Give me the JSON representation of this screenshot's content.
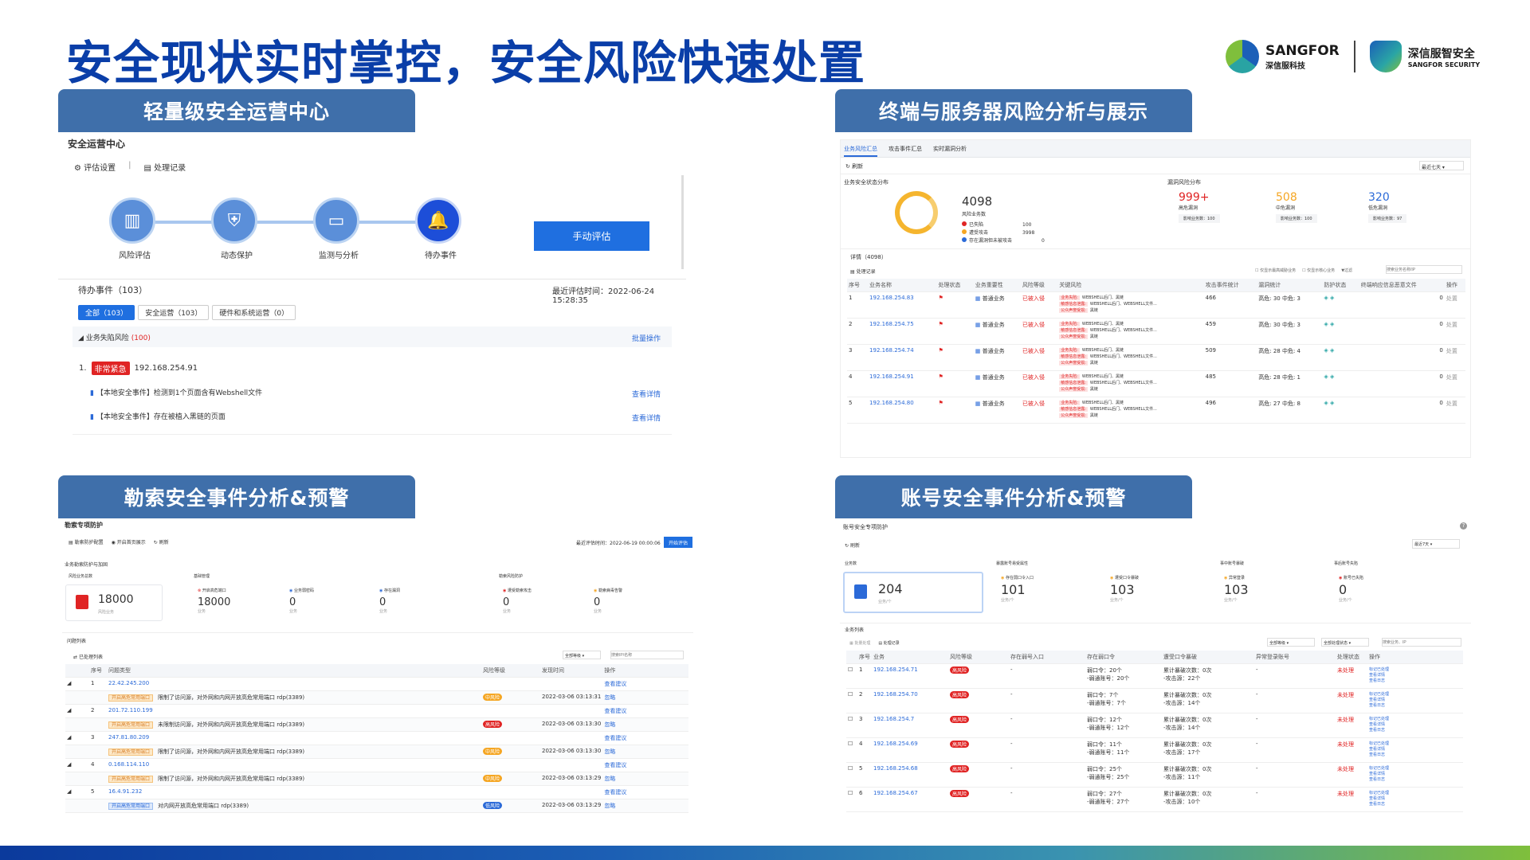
{
  "header": {
    "title": "安全现状实时掌控，安全风险快速处置",
    "logo1": {
      "name": "SANGFOR",
      "sub": "深信服科技"
    },
    "logo2": {
      "name": "深信服智安全",
      "sub": "SANGFOR SECURITY"
    }
  },
  "sections": {
    "s1": "轻量级安全运营中心",
    "s2": "终端与服务器风险分析与展示",
    "s3": "勒索安全事件分析&预警",
    "s4": "账号安全事件分析&预警"
  },
  "soc": {
    "title": "安全运营中心",
    "toolbar": {
      "settings": "评估设置",
      "records": "处理记录"
    },
    "steps": [
      "风险评估",
      "动态保护",
      "监测与分析",
      "待办事件"
    ],
    "manual_btn": "手动评估",
    "pending": "待办事件（103）",
    "last_eval": "最近评估时间：2022-06-24 15:28:35",
    "tabs": [
      "全部（103）",
      "安全运营（103）",
      "硬件和系统运营（0）"
    ],
    "group": "业务失陷风险",
    "group_count": "(100)",
    "batch": "批量操作",
    "item_no": "1.",
    "item_tag": "非常紧急",
    "item_ip": "192.168.254.91",
    "events": [
      "【本地安全事件】检测到1个页面含有Webshell文件",
      "【本地安全事件】存在被植入黑链的页面"
    ],
    "detail": "查看详情"
  },
  "terminal": {
    "tabs": [
      "业务风险汇总",
      "攻击事件汇总",
      "实时漏洞分析"
    ],
    "refresh": "刷新",
    "range": "最近七天",
    "biz_title": "业务安全状态分布",
    "total": "4098",
    "total_label": "风险业务数",
    "legend": [
      {
        "label": "已失陷",
        "value": "100",
        "color": "#e02424"
      },
      {
        "label": "遭受攻击",
        "value": "3998",
        "color": "#f5a623"
      },
      {
        "label": "存在漏洞但未被攻击",
        "value": "0",
        "color": "#2b6ad8"
      }
    ],
    "vuln_title": "漏洞风险分布",
    "vulns": [
      {
        "value": "999+",
        "label": "高危漏洞",
        "btn": "影响业务数：100",
        "color": "#e02424"
      },
      {
        "value": "508",
        "label": "中危漏洞",
        "btn": "影响业务数：100",
        "color": "#f5a623"
      },
      {
        "value": "320",
        "label": "低危漏洞",
        "btn": "影响业务数：97",
        "color": "#2b6ad8"
      }
    ],
    "detail_title": "详情（4098）",
    "process": "处理记录",
    "filters": [
      "仅显示最高威胁业务",
      "仅显示核心业务",
      "过滤"
    ],
    "search_ph": "搜索业务名称/IP",
    "columns": [
      "序号",
      "业务名称",
      "处理状态",
      "业务重要性",
      "风险等级",
      "关键风险",
      "攻击事件统计",
      "漏洞统计",
      "防护状态",
      "终端响应信息恶意文件",
      "操作"
    ],
    "rows": [
      {
        "no": "1",
        "ip": "192.168.254.83",
        "imp": "普通业务",
        "level": "已被入侵",
        "atk": "466",
        "vul": "高危: 30  中危: 3"
      },
      {
        "no": "2",
        "ip": "192.168.254.75",
        "imp": "普通业务",
        "level": "已被入侵",
        "atk": "459",
        "vul": "高危: 30  中危: 3"
      },
      {
        "no": "3",
        "ip": "192.168.254.74",
        "imp": "普通业务",
        "level": "已被入侵",
        "atk": "509",
        "vul": "高危: 28  中危: 4"
      },
      {
        "no": "4",
        "ip": "192.168.254.91",
        "imp": "普通业务",
        "level": "已被入侵",
        "atk": "485",
        "vul": "高危: 28  中危: 1"
      },
      {
        "no": "5",
        "ip": "192.168.254.80",
        "imp": "普通业务",
        "level": "已被入侵",
        "atk": "496",
        "vul": "高危: 27  中危: 8"
      }
    ],
    "risk_lines": [
      {
        "tag": "业务失陷:",
        "text": "WEBSHELL后门、黑链"
      },
      {
        "tag": "敏感信息泄露:",
        "text": "WEBSHELL后门、WEBSHELL文件..."
      },
      {
        "tag": "公众声誉受损:",
        "text": "黑链"
      }
    ],
    "zero": "0",
    "op": "处置"
  },
  "ransom": {
    "title": "勒索专项防护",
    "toolbar": [
      "勒索防护配置",
      "开启首页展示",
      "刷新"
    ],
    "eval_time": "最近评估时间：2022-06-19 00:00:06",
    "eval_btn": "开始评估",
    "sub": "业务勒索防护与加固",
    "stats": [
      {
        "label": "风险业务总数",
        "value": "18000",
        "sub": "风险业务"
      },
      {
        "label": "开启高危端口",
        "value": "18000",
        "sub": "业务"
      },
      {
        "label": "业务弱密码",
        "value": "0",
        "sub": "业务"
      },
      {
        "label": "存在漏洞",
        "value": "0",
        "sub": "业务"
      },
      {
        "label": "遭受勒索攻击",
        "value": "0",
        "sub": "业务"
      },
      {
        "label": "勒索病毒告警",
        "value": "0",
        "sub": "业务"
      }
    ],
    "groups": [
      "基础管理",
      "勒索风险防护"
    ],
    "list_title": "问题列表",
    "process": "已处理列表",
    "filter": "全部等级",
    "search_ph": "搜索IP/名称",
    "columns": [
      "序号",
      "问题类型",
      "风险等级",
      "发现时间",
      "操作"
    ],
    "rows": [
      {
        "no": "1",
        "ip": "22.42.245.200",
        "tag": "开启高危常用端口",
        "desc": "限制了访问源，对外网和内网开放高危常用端口 rdp(3389)",
        "level": "中风险",
        "lvl": "orange",
        "time": "2022-03-06 03:13:31"
      },
      {
        "no": "2",
        "ip": "201.72.110.199",
        "tag": "开启高危常用端口",
        "desc": "未限制访问源，对外网和内网开放高危常用端口 rdp(3389)",
        "level": "高风险",
        "lvl": "red",
        "time": "2022-03-06 03:13:30"
      },
      {
        "no": "3",
        "ip": "247.81.80.209",
        "tag": "开启高危常用端口",
        "desc": "限制了访问源，对外网和内网开放高危常用端口 rdp(3389)",
        "level": "中风险",
        "lvl": "orange",
        "time": "2022-03-06 03:13:30"
      },
      {
        "no": "4",
        "ip": "0.168.114.110",
        "tag": "开启高危常用端口",
        "desc": "限制了访问源，对外网和内网开放高危常用端口 rdp(3389)",
        "level": "中风险",
        "lvl": "orange",
        "time": "2022-03-06 03:13:29"
      },
      {
        "no": "5",
        "ip": "16.4.91.232",
        "tag": "开启高危常用端口",
        "desc": "对内网开放高危常用端口 rdp(3389)",
        "level": "低风险",
        "lvl": "blue",
        "time": "2022-03-06 03:13:29"
      }
    ],
    "view": "查看建议",
    "handle": "忽略"
  },
  "account": {
    "title": "账号安全专项防护",
    "refresh": "刷新",
    "range": "最近7天",
    "cards": [
      {
        "label": "业务数",
        "value": "204",
        "sub": "业务/个"
      },
      {
        "label": "存在弱口令入口",
        "value": "101",
        "sub": "业务/个"
      },
      {
        "label": "遭受口令暴破",
        "value": "103",
        "sub": "业务/个"
      },
      {
        "label": "异常登录",
        "value": "103",
        "sub": "业务/个"
      },
      {
        "label": "账号已失陷",
        "value": "0",
        "sub": "业务/个"
      }
    ],
    "groups": [
      "暴露账号易受属性",
      "事中账号暴破",
      "事后账号失陷"
    ],
    "list_title": "业务列表",
    "batch": "批量处理",
    "process": "处理记录",
    "filter1": "全部等级",
    "filter2": "全部处理状态",
    "search_ph": "搜索业务、IP",
    "columns": [
      "序号",
      "业务",
      "风险等级",
      "存在弱号入口",
      "存在弱口令",
      "遭受口令暴破",
      "异常登录账号",
      "处理状态",
      "操作"
    ],
    "rows": [
      {
        "no": "1",
        "ip": "192.168.254.71",
        "weak": "弱口令：20个",
        "weak2": "-弱通账号：20个",
        "brute": "累计暴破次数：0次",
        "brute2": "-攻击源：22个"
      },
      {
        "no": "2",
        "ip": "192.168.254.70",
        "weak": "弱口令：7个",
        "weak2": "-弱通账号：7个",
        "brute": "累计暴破次数：0次",
        "brute2": "-攻击源：14个"
      },
      {
        "no": "3",
        "ip": "192.168.254.7",
        "weak": "弱口令：12个",
        "weak2": "-弱通账号：12个",
        "brute": "累计暴破次数：0次",
        "brute2": "-攻击源：14个"
      },
      {
        "no": "4",
        "ip": "192.168.254.69",
        "weak": "弱口令：11个",
        "weak2": "-弱通账号：11个",
        "brute": "累计暴破次数：0次",
        "brute2": "-攻击源：17个"
      },
      {
        "no": "5",
        "ip": "192.168.254.68",
        "weak": "弱口令：25个",
        "weak2": "-弱通账号：25个",
        "brute": "累计暴破次数：0次",
        "brute2": "-攻击源：11个"
      },
      {
        "no": "6",
        "ip": "192.168.254.67",
        "weak": "弱口令：27个",
        "weak2": "-弱通账号：27个",
        "brute": "累计暴破次数：0次",
        "brute2": "-攻击源：10个"
      }
    ],
    "level": "高风险",
    "status": "未处理",
    "ops": [
      "标记已处理",
      "查看详情",
      "查看日志"
    ]
  }
}
